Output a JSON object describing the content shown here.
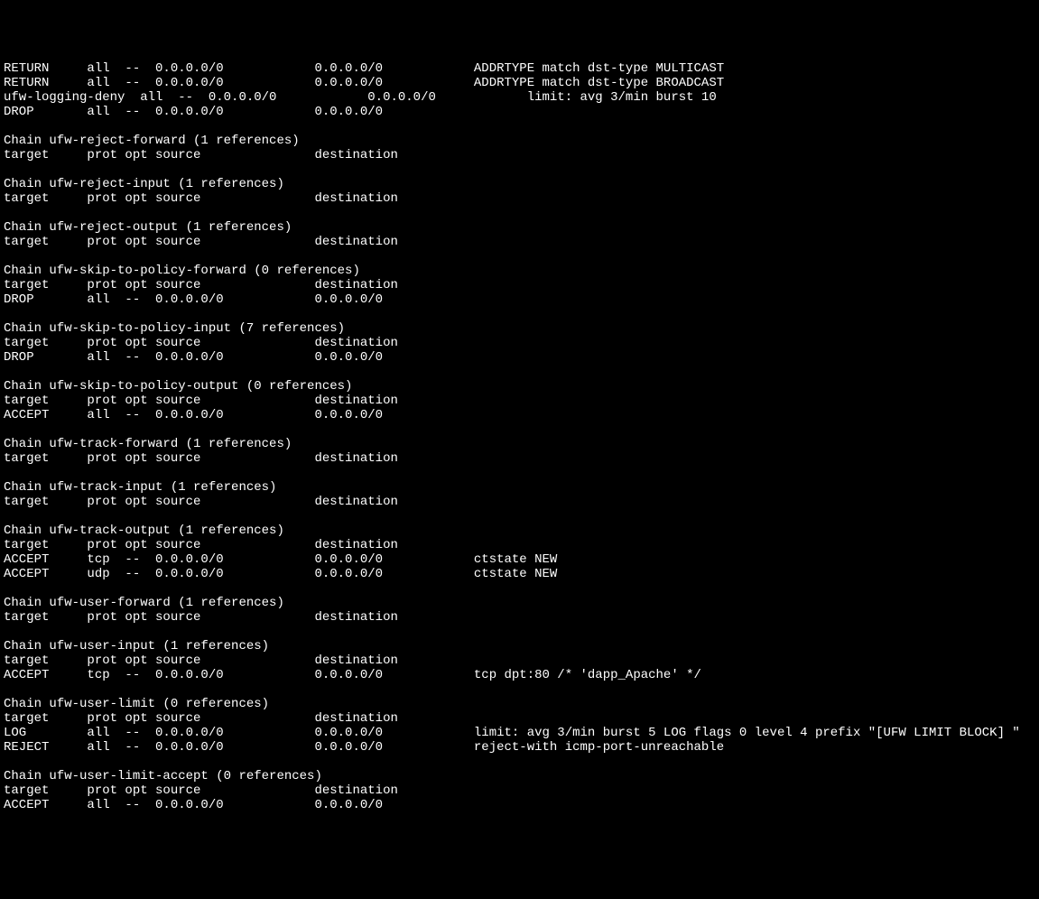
{
  "lines": [
    "RETURN     all  --  0.0.0.0/0            0.0.0.0/0            ADDRTYPE match dst-type MULTICAST",
    "RETURN     all  --  0.0.0.0/0            0.0.0.0/0            ADDRTYPE match dst-type BROADCAST",
    "ufw-logging-deny  all  --  0.0.0.0/0            0.0.0.0/0            limit: avg 3/min burst 10",
    "DROP       all  --  0.0.0.0/0            0.0.0.0/0",
    "",
    "Chain ufw-reject-forward (1 references)",
    "target     prot opt source               destination",
    "",
    "Chain ufw-reject-input (1 references)",
    "target     prot opt source               destination",
    "",
    "Chain ufw-reject-output (1 references)",
    "target     prot opt source               destination",
    "",
    "Chain ufw-skip-to-policy-forward (0 references)",
    "target     prot opt source               destination",
    "DROP       all  --  0.0.0.0/0            0.0.0.0/0",
    "",
    "Chain ufw-skip-to-policy-input (7 references)",
    "target     prot opt source               destination",
    "DROP       all  --  0.0.0.0/0            0.0.0.0/0",
    "",
    "Chain ufw-skip-to-policy-output (0 references)",
    "target     prot opt source               destination",
    "ACCEPT     all  --  0.0.0.0/0            0.0.0.0/0",
    "",
    "Chain ufw-track-forward (1 references)",
    "target     prot opt source               destination",
    "",
    "Chain ufw-track-input (1 references)",
    "target     prot opt source               destination",
    "",
    "Chain ufw-track-output (1 references)",
    "target     prot opt source               destination",
    "ACCEPT     tcp  --  0.0.0.0/0            0.0.0.0/0            ctstate NEW",
    "ACCEPT     udp  --  0.0.0.0/0            0.0.0.0/0            ctstate NEW",
    "",
    "Chain ufw-user-forward (1 references)",
    "target     prot opt source               destination",
    "",
    "Chain ufw-user-input (1 references)",
    "target     prot opt source               destination",
    "ACCEPT     tcp  --  0.0.0.0/0            0.0.0.0/0            tcp dpt:80 /* 'dapp_Apache' */",
    "",
    "Chain ufw-user-limit (0 references)",
    "target     prot opt source               destination",
    "LOG        all  --  0.0.0.0/0            0.0.0.0/0            limit: avg 3/min burst 5 LOG flags 0 level 4 prefix \"[UFW LIMIT BLOCK] \"",
    "REJECT     all  --  0.0.0.0/0            0.0.0.0/0            reject-with icmp-port-unreachable",
    "",
    "Chain ufw-user-limit-accept (0 references)",
    "target     prot opt source               destination",
    "ACCEPT     all  --  0.0.0.0/0            0.0.0.0/0",
    ""
  ]
}
